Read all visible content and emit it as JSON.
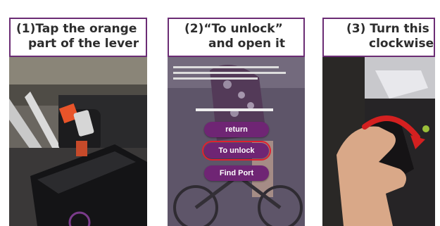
{
  "steps": [
    {
      "number": "(1)",
      "caption_line1": "(1)Tap the orange",
      "caption_line2": "part of the lever"
    },
    {
      "number": "(2)",
      "caption_line1": "(2)“To unlock”",
      "caption_line2": "and open it"
    },
    {
      "number": "(3)",
      "caption_line1": "(3) Turn this",
      "caption_line2": "clockwise"
    }
  ],
  "phone_screen": {
    "buttons": [
      {
        "label": "return"
      },
      {
        "label": "To unlock"
      },
      {
        "label": "Find Port"
      }
    ],
    "highlighted_button": "To unlock"
  },
  "colors": {
    "caption_border": "#6b2c74",
    "button_fill": "#6f2574",
    "highlight_outline": "#e02030",
    "lever_orange": "#e8542a",
    "arrow_red": "#d42020"
  }
}
